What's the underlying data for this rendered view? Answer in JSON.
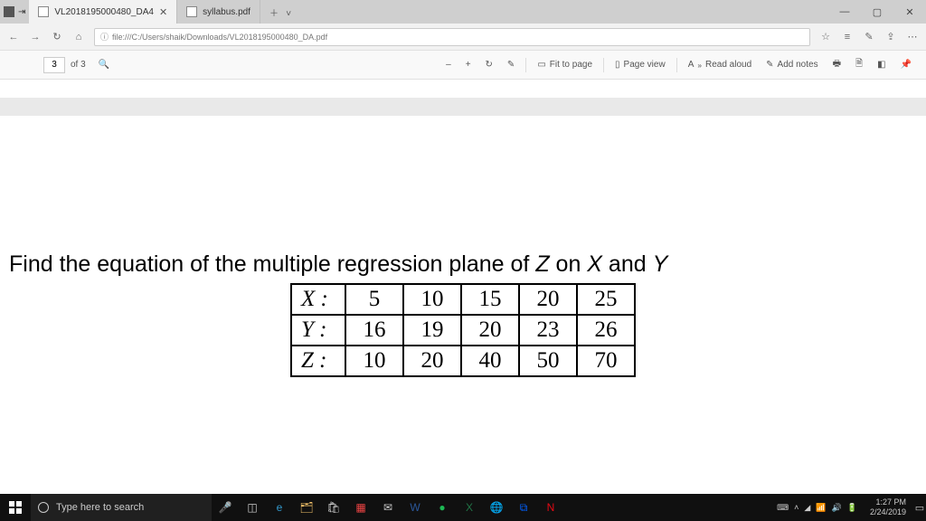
{
  "browser": {
    "tabs": [
      {
        "title": "VL2018195000480_DA4",
        "active": true
      },
      {
        "title": "syllabus.pdf",
        "active": false
      }
    ],
    "url": "file:///C:/Users/shaik/Downloads/VL2018195000480_DA.pdf",
    "window_controls": {
      "min": "—",
      "max": "▢",
      "close": "✕"
    }
  },
  "pdf_toolbar": {
    "page_current": "3",
    "page_label_prefix": "of",
    "page_total": "3",
    "tools": {
      "minus": "–",
      "plus": "+",
      "rotate": "↻",
      "draw": "✎",
      "fit": "Fit to page",
      "pageview": "Page view",
      "readaloud": "Read aloud",
      "addnotes": "Add notes"
    }
  },
  "content": {
    "question_pre": "Find the equation of the multiple regression plane of ",
    "z": "Z",
    "mid": " on ",
    "x": "X",
    "and": " and ",
    "y": "Y",
    "table": {
      "rows": [
        {
          "label": "X :",
          "v": [
            "5",
            "10",
            "15",
            "20",
            "25"
          ]
        },
        {
          "label": "Y :",
          "v": [
            "16",
            "19",
            "20",
            "23",
            "26"
          ]
        },
        {
          "label": "Z :",
          "v": [
            "10",
            "20",
            "40",
            "50",
            "70"
          ]
        }
      ]
    }
  },
  "taskbar": {
    "search_placeholder": "Type here to search",
    "time": "1:27 PM",
    "date": "2/24/2019"
  }
}
